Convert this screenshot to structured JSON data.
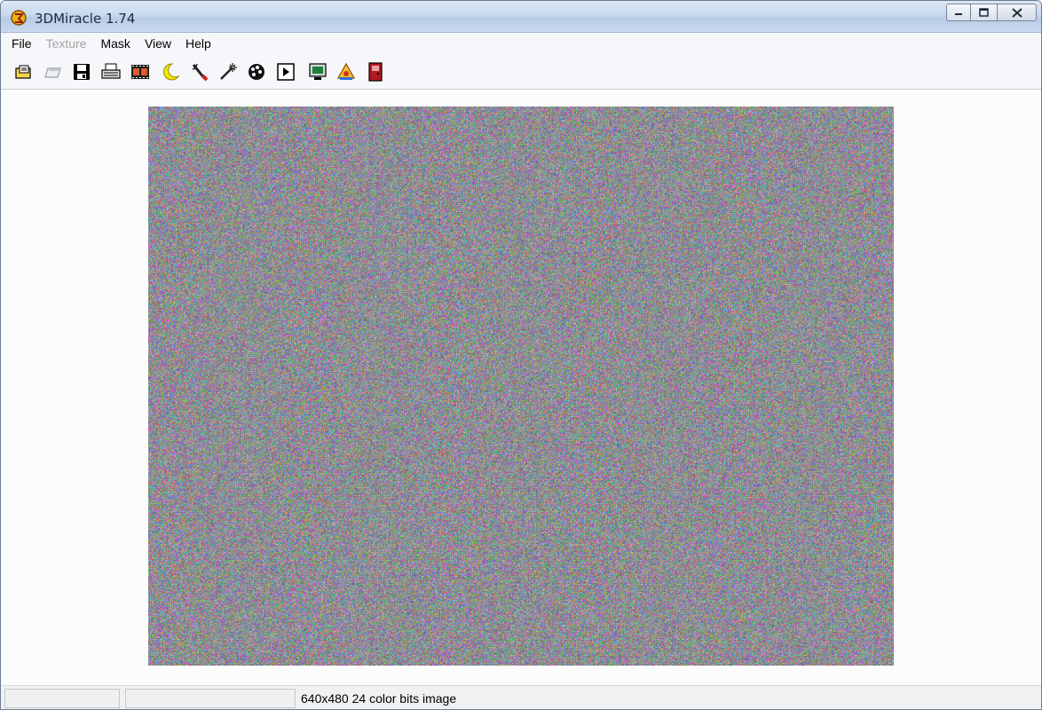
{
  "window": {
    "title": "3DMiracle 1.74",
    "title_icon": "app-logo-icon"
  },
  "menu": {
    "items": [
      {
        "label": "File",
        "enabled": true
      },
      {
        "label": "Texture",
        "enabled": false
      },
      {
        "label": "Mask",
        "enabled": true
      },
      {
        "label": "View",
        "enabled": true
      },
      {
        "label": "Help",
        "enabled": true
      }
    ]
  },
  "toolbar": {
    "icons": [
      "open-image-icon",
      "open-texture-icon",
      "save-icon",
      "print-icon",
      "film-strip-icon",
      "moon-icon",
      "magic-wand-brush-icon",
      "magic-wand-icon",
      "palette-icon",
      "play-icon",
      "monitor-icon",
      "paint-bucket-icon",
      "exit-door-icon"
    ]
  },
  "image": {
    "description": "random-dot stereogram"
  },
  "status": {
    "text": "640x480 24 color bits image"
  },
  "colors": {
    "title_gradient_top": "#dce7f5",
    "title_gradient_bottom": "#b9cce6",
    "disabled_text": "#a3a3a3"
  }
}
